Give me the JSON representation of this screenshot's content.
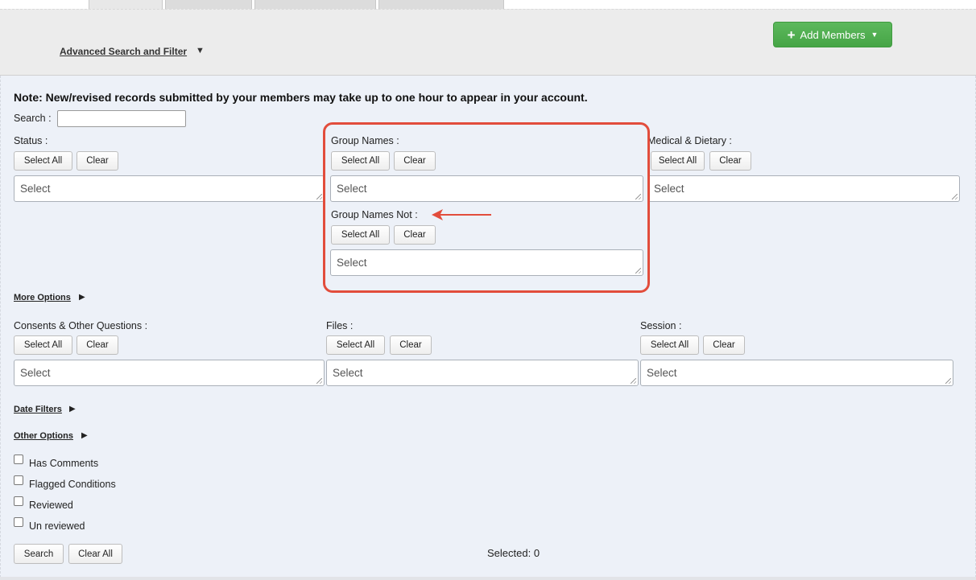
{
  "header": {
    "advanced_search_label": "Advanced Search and Filter",
    "advanced_search_caret": "▼",
    "add_members_label": "Add Members",
    "add_members_icon": "plus-icon",
    "accent_color": "#5cb85c"
  },
  "note": "Note: New/revised records submitted by your members may take up to one hour to appear in your account.",
  "search": {
    "label": "Search :",
    "value": ""
  },
  "buttons": {
    "select_all": "Select All",
    "clear": "Clear"
  },
  "select_placeholder": "Select",
  "filters": {
    "status": {
      "label": "Status :"
    },
    "group_names": {
      "label": "Group Names :"
    },
    "medical": {
      "label": "Medical & Dietary :"
    },
    "group_names_not": {
      "label": "Group Names Not :"
    },
    "consents": {
      "label": "Consents & Other Questions :"
    },
    "files": {
      "label": "Files :"
    },
    "session": {
      "label": "Session :"
    }
  },
  "sections": {
    "more_options": "More Options",
    "date_filters": "Date Filters",
    "other_options": "Other Options",
    "collapsed_marker": "▶"
  },
  "checkboxes": [
    {
      "label": "Has Comments",
      "checked": false
    },
    {
      "label": "Flagged Conditions",
      "checked": false
    },
    {
      "label": "Reviewed",
      "checked": false
    },
    {
      "label": "Un reviewed",
      "checked": false
    }
  ],
  "footer": {
    "search_button": "Search",
    "clear_all_button": "Clear All",
    "selected_text": "Selected: 0"
  },
  "annotation": {
    "highlight_color": "#e24d3c"
  }
}
